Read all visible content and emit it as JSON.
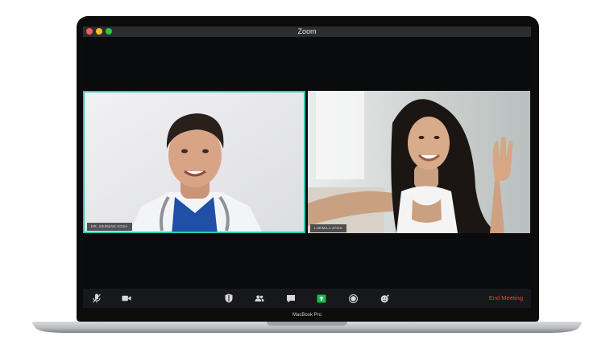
{
  "device": {
    "brand_label": "MacBook Pro"
  },
  "window": {
    "title": "Zoom"
  },
  "participants": [
    {
      "name": "DR. GERMAN SOSA",
      "active_speaker": true
    },
    {
      "name": "LUDMILA ZANS",
      "active_speaker": false
    }
  ],
  "toolbar": {
    "buttons": [
      {
        "name": "mute-mic",
        "icon": "microphone-icon"
      },
      {
        "name": "stop-video",
        "icon": "video-camera-icon"
      },
      {
        "name": "security",
        "icon": "shield-icon"
      },
      {
        "name": "participants",
        "icon": "participants-icon"
      },
      {
        "name": "chat",
        "icon": "chat-icon"
      },
      {
        "name": "share-screen",
        "icon": "share-screen-icon"
      },
      {
        "name": "record",
        "icon": "record-icon"
      },
      {
        "name": "reactions",
        "icon": "reactions-icon"
      }
    ],
    "end_meeting_label": "End Meeting"
  },
  "colors": {
    "active_speaker_border": "#2fc9b1",
    "share_screen": "#1fb84a",
    "end_meeting": "#f0403c"
  }
}
